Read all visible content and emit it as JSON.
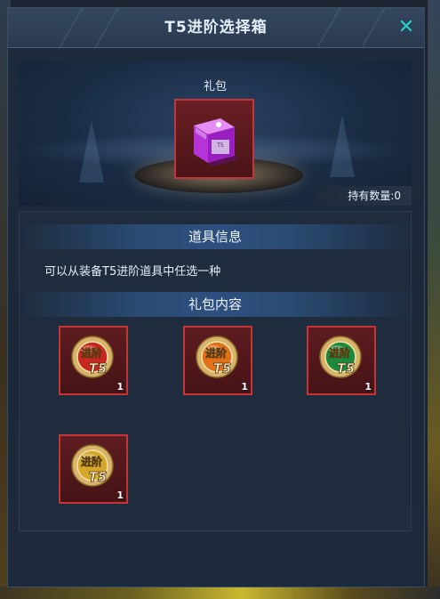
{
  "window": {
    "title": "T5进阶选择箱",
    "close_icon": "close-icon"
  },
  "package": {
    "label": "礼包",
    "icon": "gift-box-icon",
    "box_text": "T5",
    "held_label": "持有数量:0"
  },
  "info": {
    "header": "道具信息",
    "description": "可以从装备T5进阶道具中任选一种"
  },
  "contents": {
    "header": "礼包内容",
    "items": [
      {
        "name": "T5 advance item (red)",
        "icon": "t5-advance-badge-red",
        "badge_top": "进阶",
        "badge_bottom": "T5",
        "qty": "1",
        "color": "#c8261e"
      },
      {
        "name": "T5 advance item (orange)",
        "icon": "t5-advance-badge-orange",
        "badge_top": "进阶",
        "badge_bottom": "T5",
        "qty": "1",
        "color": "#e0701a"
      },
      {
        "name": "T5 advance item (green/blue)",
        "icon": "t5-advance-badge-green",
        "badge_top": "进阶",
        "badge_bottom": "T5",
        "qty": "1",
        "color": "#1c8a3c"
      },
      {
        "name": "T5 advance item (gold)",
        "icon": "t5-advance-badge-gold",
        "badge_top": "进阶",
        "badge_bottom": "T5",
        "qty": "1",
        "color": "#d6a82a"
      }
    ]
  },
  "colors": {
    "accent": "#28d2c8",
    "slot_border": "#c43538",
    "panel": "#1d2b3d"
  }
}
